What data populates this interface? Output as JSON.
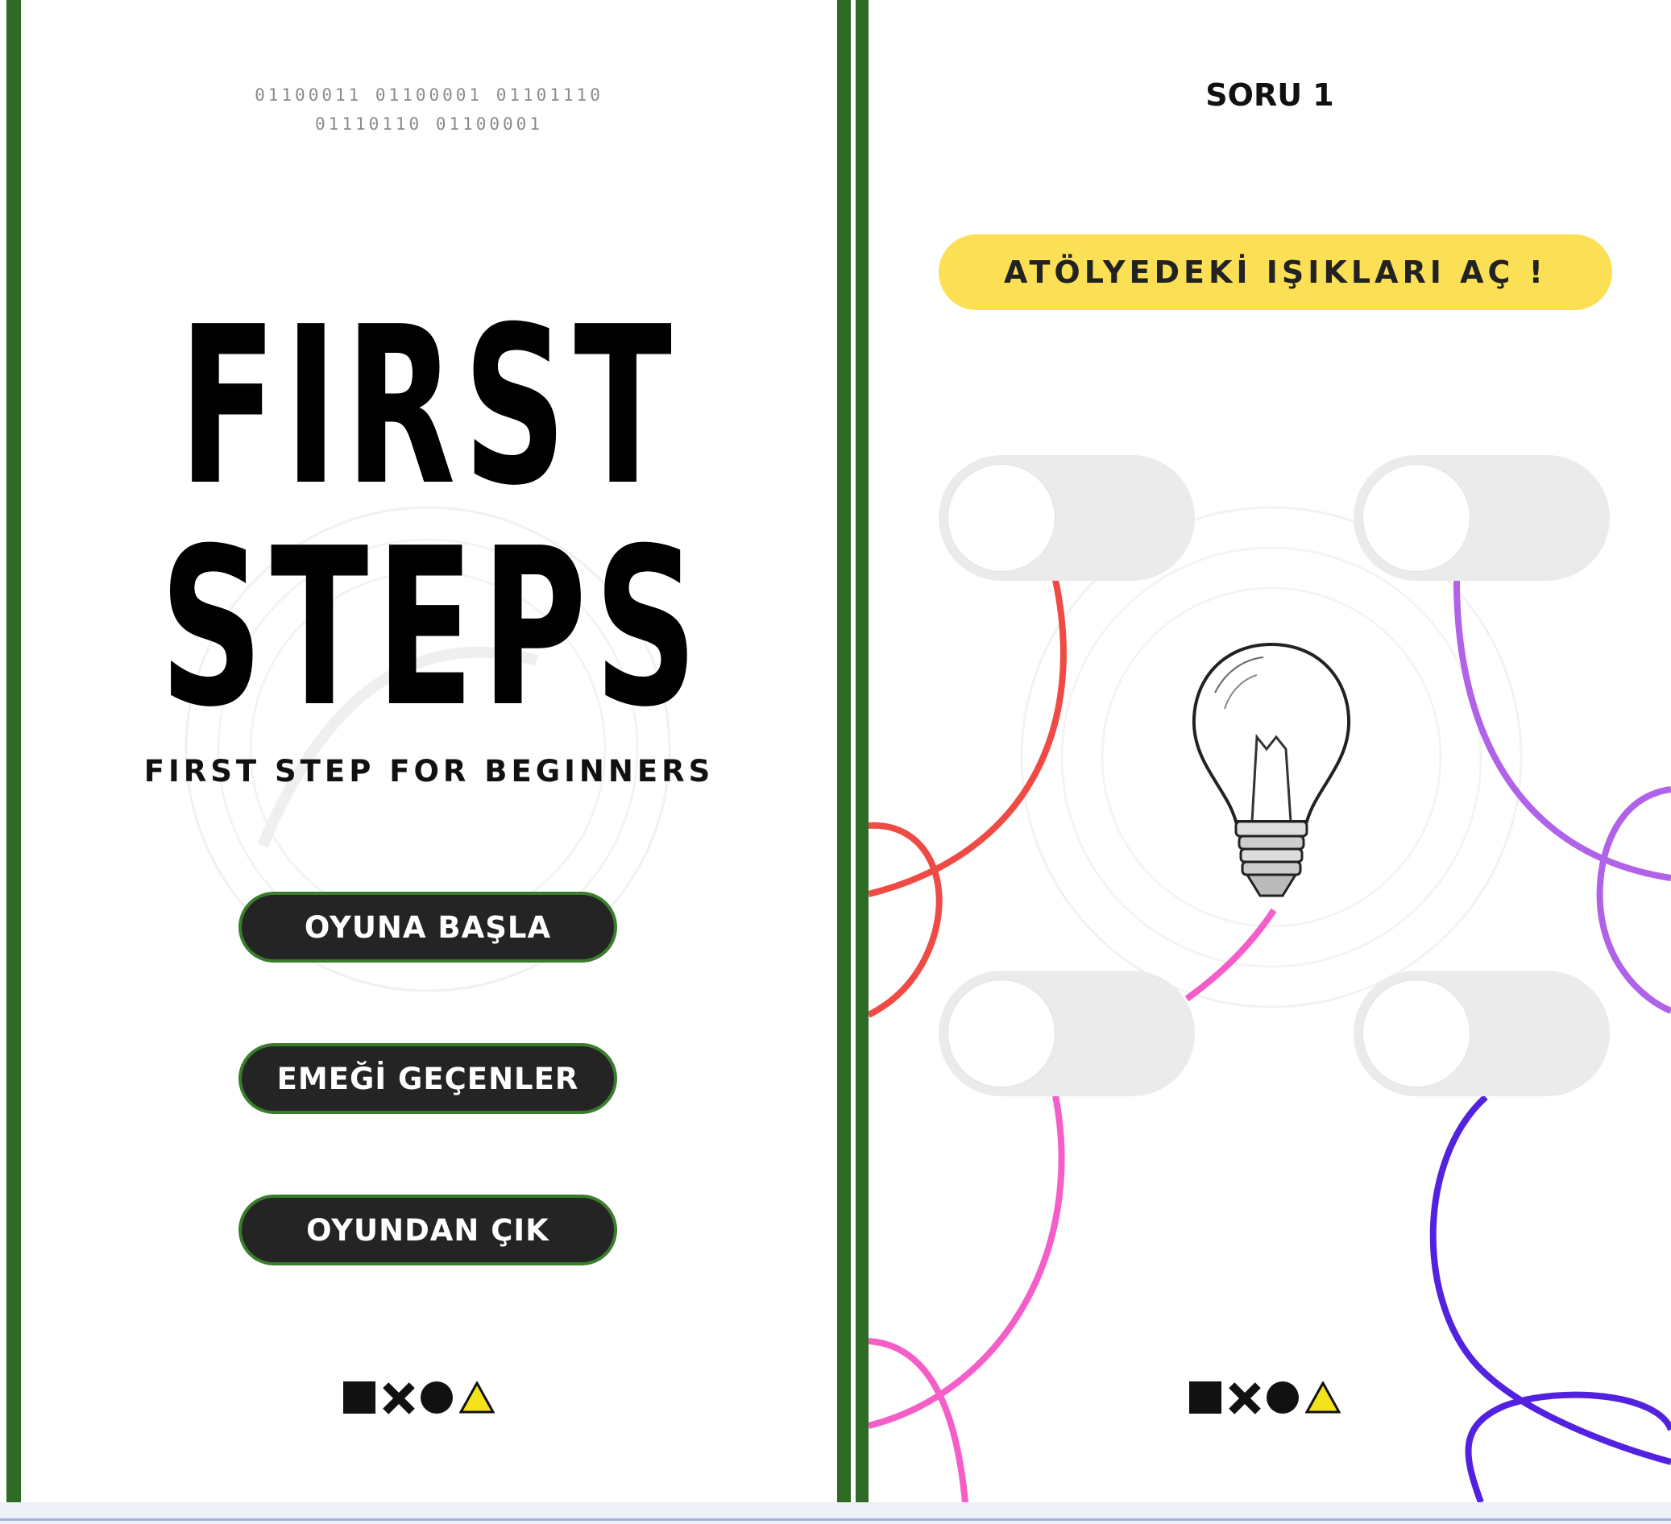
{
  "colors": {
    "divider_green": "#2e6b24",
    "button_dark": "#232423",
    "button_border_green": "#3a7d2c",
    "pill_yellow": "#fbe056",
    "toggle_track": "#ebebeb",
    "wire_red": "#f04a45",
    "wire_pink": "#f55ec8",
    "wire_purple": "#b062e8",
    "wire_indigo": "#5322e0"
  },
  "left_screen": {
    "binary_line_1": "01100011 01100001 01101110",
    "binary_line_2": "01110110 01100001",
    "title_line_1": "FIRST",
    "title_line_2": "STEPS",
    "subtitle": "FIRST STEP FOR BEGINNERS",
    "menu": [
      {
        "label": "OYUNA BAŞLA"
      },
      {
        "label": "EMEĞİ GEÇENLER"
      },
      {
        "label": "OYUNDAN ÇIK"
      }
    ],
    "shape_icons": [
      "square-icon",
      "x-icon",
      "circle-icon",
      "triangle-icon"
    ]
  },
  "right_screen": {
    "question_title": "SORU 1",
    "task_text": "ATÖLYEDEKİ IŞIKLARI AÇ !",
    "switches": [
      {
        "state": "off"
      },
      {
        "state": "off"
      },
      {
        "state": "off"
      },
      {
        "state": "off"
      }
    ],
    "center_icon": "light-bulb-icon",
    "shape_icons": [
      "square-icon",
      "x-icon",
      "circle-icon",
      "triangle-icon"
    ]
  }
}
